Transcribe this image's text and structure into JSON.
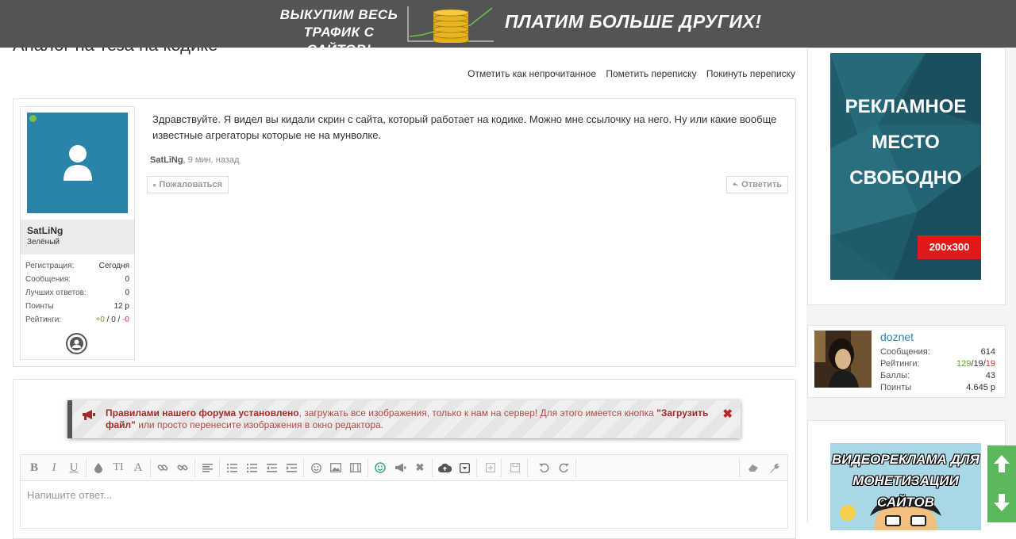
{
  "banner": {
    "left_line1": "ВЫКУПИМ ВЕСЬ",
    "left_line2": "ТРАФИК С САЙТОВ!",
    "right_text": "ПЛАТИМ БОЛЬШЕ ДРУГИХ!"
  },
  "thread": {
    "title": "Аналог на теза на кодике",
    "actions": [
      "Отметить как непрочитанное",
      "Пометить переписку",
      "Покинуть переписку"
    ]
  },
  "post": {
    "author": {
      "name": "SatLiNg",
      "group": "Зелёный",
      "online": true,
      "stats": [
        {
          "label": "Регистрация:",
          "value": "Сегодня"
        },
        {
          "label": "Сообщения:",
          "value": "0"
        },
        {
          "label": "Лучших ответов:",
          "value": "0"
        },
        {
          "label": "Поинты",
          "value": "12 р"
        }
      ],
      "ratings_label": "Рейтинги:",
      "ratings": {
        "pos": "+0",
        "sep1": " / ",
        "mid": "0",
        "sep2": " / ",
        "neg": "-0"
      }
    },
    "text": "Здравствуйте. Я видел вы кидали скрин с сайта, который работает на кодике. Можно мне ссылочку на него. Ну или какие вообще известные агрегаторы которые не на мунволке.",
    "meta_author": "SatLiNg",
    "meta_time": ", 9 мин. назад",
    "report_label": "Пожаловаться",
    "reply_label": "Ответить"
  },
  "notice": {
    "bold_part": "Правилами нашего форума установлено",
    "text_part": ", загружать все изображения, только к нам на сервер! Для этого имеется кнопка ",
    "button_name": "\"Загрузить файл\"",
    "end_part": " или просто перенесите изображения в окно редактора."
  },
  "editor": {
    "placeholder": "Напишите ответ..."
  },
  "sidebar": {
    "ad1": {
      "line1": "РЕКЛАМНОЕ",
      "line2": "МЕСТО",
      "line3": "СВОБОДНО",
      "size": "200x300"
    },
    "user": {
      "name": "doznet",
      "stats": [
        {
          "label": "Сообщения:",
          "value": "614"
        },
        {
          "label": "Баллы:",
          "value": "43"
        },
        {
          "label": "Поинты",
          "value": "4.645 р"
        }
      ],
      "ratings_label": "Рейтинги:",
      "ratings": {
        "pos": "129",
        "mid": "19",
        "neg": "19"
      }
    },
    "ad2": {
      "line1": "ВИДЕОРЕКЛАМА ДЛЯ",
      "line2": "МОНЕТИЗАЦИИ САЙТОВ"
    }
  },
  "colors": {
    "accent": "#2a84a8",
    "positive": "#5aa626",
    "negative": "#d9302b",
    "scroll": "#5cb85c"
  }
}
